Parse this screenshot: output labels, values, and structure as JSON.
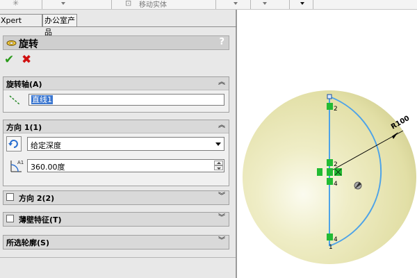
{
  "toolbar": {
    "star_glyph": "✳",
    "move_icon_glyph": "⊡",
    "move_body_label": "移动实体"
  },
  "tabs": [
    {
      "label": "Xpert"
    },
    {
      "label": "办公室产品"
    }
  ],
  "feature": {
    "title": "旋转",
    "help": "?",
    "ok": "✔",
    "cancel": "✖"
  },
  "axis_group": {
    "title": "旋转轴(A)",
    "collapse": "︽",
    "selection": "直线1"
  },
  "direction1": {
    "title": "方向 1(1)",
    "collapse": "︽",
    "end_condition": "给定深度",
    "angle": "360.00度"
  },
  "direction2": {
    "title": "方向 2(2)",
    "expand": "︾"
  },
  "thin_feature": {
    "title": "薄壁特征(T)",
    "expand": "︾"
  },
  "contours": {
    "title": "所选轮廓(S)",
    "expand": "︾"
  },
  "viewport": {
    "dimension_label": "R100",
    "relation_labels": [
      "2",
      "2",
      "4",
      "4",
      "1"
    ],
    "colors": {
      "sphere": "#eeecbe",
      "sketch_line": "#4da3e8",
      "relation_marker": "#22bb33"
    }
  }
}
